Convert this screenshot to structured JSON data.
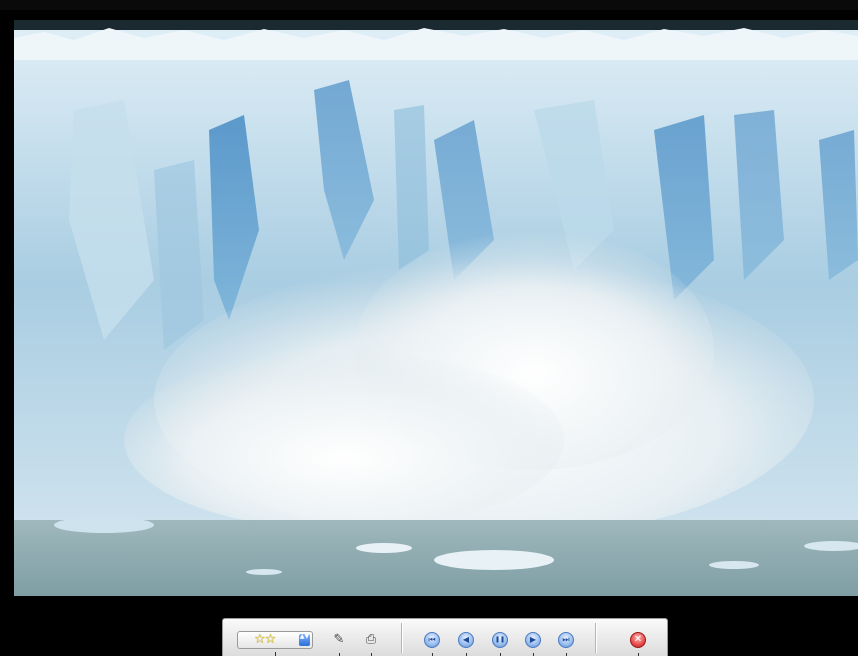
{
  "viewer": {
    "background": "#000000",
    "photo": {
      "subject": "glacier-calving-photo"
    }
  },
  "toolbar": {
    "rating": {
      "value_stars": 2,
      "stars_text": "☆☆",
      "icon": "star-rating-icon",
      "stepper_icon": "up-down-stepper-icon",
      "stepper_text": "▲▼"
    },
    "tools": [
      {
        "icon": "edit-image-icon",
        "glyph": "✎"
      },
      {
        "icon": "print-icon",
        "glyph": "⎙"
      }
    ],
    "playback": [
      {
        "icon": "first-image-icon",
        "glyph": "⏮"
      },
      {
        "icon": "previous-image-icon",
        "glyph": "◀"
      },
      {
        "icon": "pause-slideshow-icon",
        "glyph": "❚❚"
      },
      {
        "icon": "next-image-icon",
        "glyph": "▶"
      },
      {
        "icon": "last-image-icon",
        "glyph": "⏭"
      }
    ],
    "close": {
      "icon": "close-icon",
      "glyph": "✕"
    },
    "colors": {
      "nav_button": "#5b8fd6",
      "close_button": "#e84c4c",
      "star": "#e8c81c"
    }
  }
}
